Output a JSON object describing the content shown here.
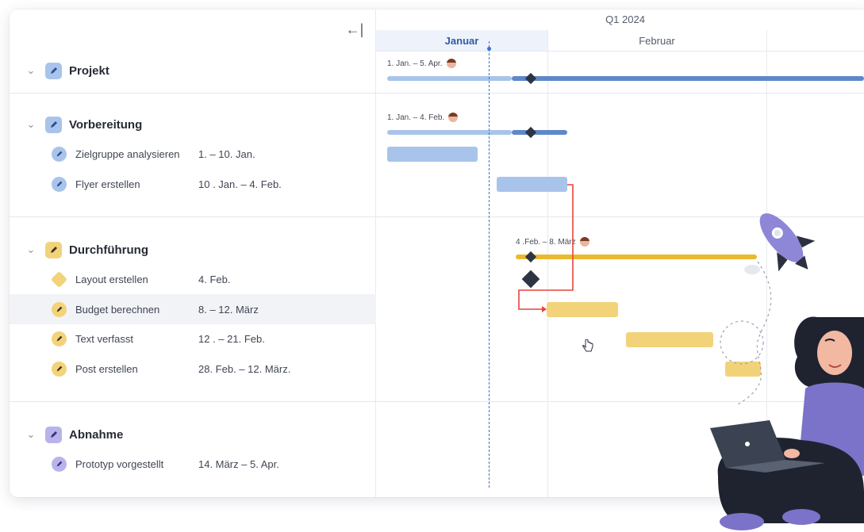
{
  "toolbar": {
    "collapse_icon": "←|"
  },
  "timeline": {
    "quarter": "Q1 2024",
    "months": [
      {
        "label": "Januar",
        "active": true
      },
      {
        "label": "Februar",
        "active": false
      }
    ]
  },
  "groups": [
    {
      "label": "Projekt",
      "color": "#7fa6df",
      "bar_label": "1. Jan. – 5. Apr."
    },
    {
      "label": "Vorbereitung",
      "color": "#7fa6df",
      "bar_label": "1. Jan. – 4. Feb."
    },
    {
      "label": "Durchführung",
      "color": "#f2c94c",
      "bar_label": "4 .Feb. – 8. März"
    },
    {
      "label": "Abnahme",
      "color": "#8e86d6",
      "bar_label": ""
    }
  ],
  "tasks": [
    {
      "label": "Zielgruppe analysieren",
      "date": "1. – 10. Jan."
    },
    {
      "label": "Flyer erstellen",
      "date": "10 . Jan. – 4. Feb."
    },
    {
      "label": "Layout erstellen",
      "date": "4. Feb."
    },
    {
      "label": "Budget berechnen",
      "date": "8. – 12. März"
    },
    {
      "label": "Text verfasst",
      "date": "12 . – 21. Feb."
    },
    {
      "label": "Post erstellen",
      "date": "28. Feb. – 12. März."
    },
    {
      "label": "Prototyp vorgestellt",
      "date": "14. März – 5. Apr."
    }
  ],
  "colors": {
    "blue_light": "#a9c4ea",
    "blue_dark": "#5f88c9",
    "yellow": "#f2d37a",
    "yellow_dark": "#eab92f",
    "purple": "#8e86d6",
    "dependency": "#e5443b",
    "today": "#3a6fd8"
  },
  "icons": {
    "chevron": "chevron-down-icon",
    "edit": "pencil-icon",
    "collapse": "collapse-left-icon",
    "cursor": "hand-pointer-icon"
  }
}
